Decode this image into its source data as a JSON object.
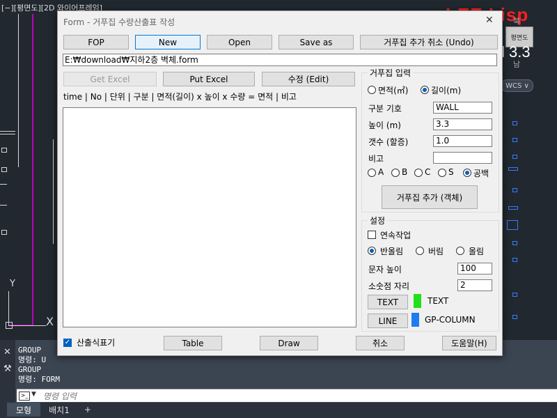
{
  "cad": {
    "viewport_label": "[−][평면도][2D 와이어프레임]",
    "brand": "LEE Lisp",
    "version": "l 3.3",
    "viewcube_face": "평면도",
    "viewcube_north": "북",
    "viewcube_south": "남",
    "wcs_label": "WCS ∨",
    "axis_y": "Y",
    "axis_x": "X"
  },
  "dialog": {
    "title": "Form - 거푸집 수량산출표 작성",
    "close_glyph": "✕",
    "toolbar": {
      "fop": "FOP",
      "new": "New",
      "open": "Open",
      "save_as": "Save as",
      "undo": "거푸집 추가 취소 (Undo)"
    },
    "file_path": "E:₩download₩지하2층 벽체.form",
    "actions": {
      "get_excel": "Get Excel",
      "put_excel": "Put Excel",
      "edit": "수정 (Edit)"
    },
    "columns_header": "time | No | 단위 | 구분 | 면적(길이) x 높이 x 수량 = 면적 | 비고",
    "input_group": {
      "legend": "거푸집 입력",
      "area_option": "면적(㎡)",
      "length_option": "길이(m)",
      "selected_unit": "length",
      "code_label": "구분 기호",
      "code_value": "WALL",
      "height_label": "높이 (m)",
      "height_value": "3.3",
      "count_label": "갯수 (할증)",
      "count_value": "1.0",
      "note_label": "비고",
      "note_value": "",
      "side_options": [
        "A",
        "B",
        "C",
        "S",
        "공백"
      ],
      "side_selected": "공백",
      "add_button": "거푸집 추가 (객체)"
    },
    "settings_group": {
      "legend": "설정",
      "continuous_label": "연속작업",
      "continuous_checked": false,
      "rounding_options": [
        "반올림",
        "버림",
        "올림"
      ],
      "rounding_selected": "반올림",
      "text_height_label": "문자 높이",
      "text_height_value": "100",
      "decimals_label": "소숫점 자리",
      "decimals_value": "2",
      "text_button": "TEXT",
      "text_layer": "TEXT",
      "text_color": "#22e01a",
      "line_button": "LINE",
      "line_layer": "GP-COLUMN",
      "line_color": "#1f7cf0"
    },
    "bottom": {
      "marker_label": "산출식표기",
      "marker_checked": true,
      "table": "Table",
      "draw": "Draw",
      "cancel": "취소",
      "help": "도움말(H)"
    }
  },
  "command": {
    "history": [
      "GROUP",
      "명령:  U",
      "GROUP",
      "명령: FORM"
    ],
    "placeholder": "명령 입력"
  },
  "layout_tabs": {
    "model": "모형",
    "layout1": "배치1",
    "add": "+"
  }
}
